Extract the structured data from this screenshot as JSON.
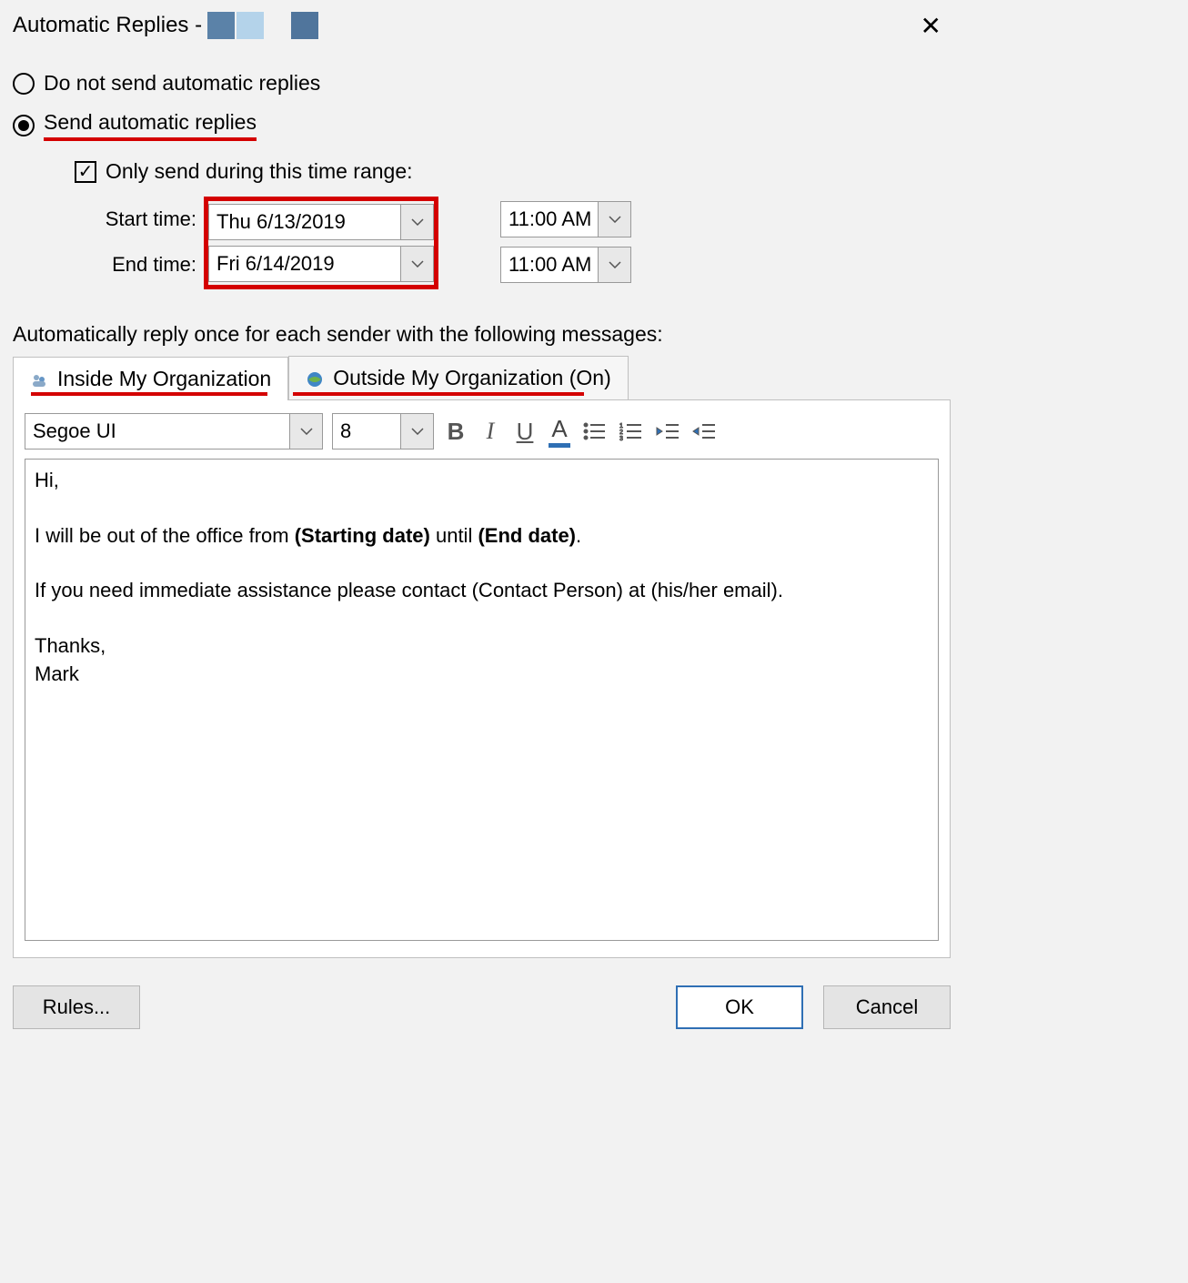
{
  "title": "Automatic Replies -",
  "radios": {
    "noSend": "Do not send automatic replies",
    "send": "Send automatic replies"
  },
  "checkbox": {
    "onlySend": "Only send during this time range:"
  },
  "labels": {
    "start": "Start time:",
    "end": "End time:"
  },
  "dates": {
    "startDate": "Thu 6/13/2019",
    "startTime": "11:00 AM",
    "endDate": "Fri 6/14/2019",
    "endTime": "11:00 AM"
  },
  "desc": "Automatically reply once for each sender with the following messages:",
  "tabs": {
    "inside": "Inside My Organization",
    "outside": "Outside My Organization (On)"
  },
  "toolbar": {
    "font": "Segoe UI",
    "size": "8"
  },
  "message": {
    "l1": "Hi,",
    "l2a": "I will be out of the office from ",
    "l2b": "(Starting date)",
    "l2c": " until ",
    "l2d": "(End date)",
    "l2e": ".",
    "l3": "If you need immediate assistance please contact (Contact Person) at (his/her email).",
    "l4": "Thanks,",
    "l5": "Mark"
  },
  "buttons": {
    "rules": "Rules...",
    "ok": "OK",
    "cancel": "Cancel"
  }
}
